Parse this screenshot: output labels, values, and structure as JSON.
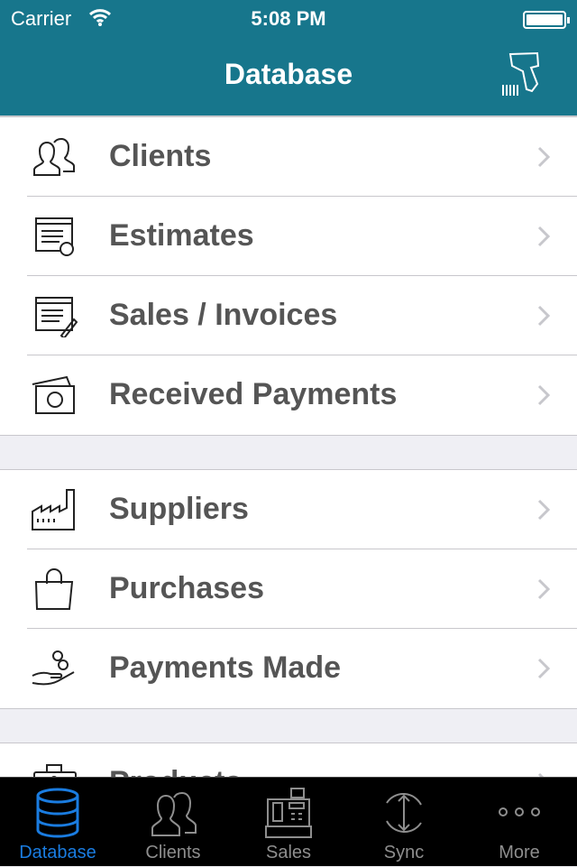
{
  "status_bar": {
    "carrier": "Carrier",
    "time": "5:08 PM",
    "battery_level": 1.0
  },
  "header": {
    "title": "Database",
    "right_icon": "barcode-scanner-icon"
  },
  "groups": [
    {
      "items": [
        {
          "label": "Clients",
          "icon": "clients-icon"
        },
        {
          "label": "Estimates",
          "icon": "estimates-icon"
        },
        {
          "label": "Sales / Invoices",
          "icon": "invoice-icon"
        },
        {
          "label": "Received Payments",
          "icon": "money-icon"
        }
      ]
    },
    {
      "items": [
        {
          "label": "Suppliers",
          "icon": "factory-icon"
        },
        {
          "label": "Purchases",
          "icon": "shopping-bag-icon"
        },
        {
          "label": "Payments Made",
          "icon": "hand-coins-icon"
        }
      ]
    },
    {
      "items": [
        {
          "label": "Products",
          "icon": "briefcase-icon"
        }
      ]
    }
  ],
  "tabbar": {
    "active": "Database",
    "accent": "#1a7ce0",
    "items": [
      {
        "label": "Database",
        "icon": "database-icon"
      },
      {
        "label": "Clients",
        "icon": "clients-icon"
      },
      {
        "label": "Sales",
        "icon": "cash-register-icon"
      },
      {
        "label": "Sync",
        "icon": "sync-icon"
      },
      {
        "label": "More",
        "icon": "more-icon"
      }
    ]
  }
}
